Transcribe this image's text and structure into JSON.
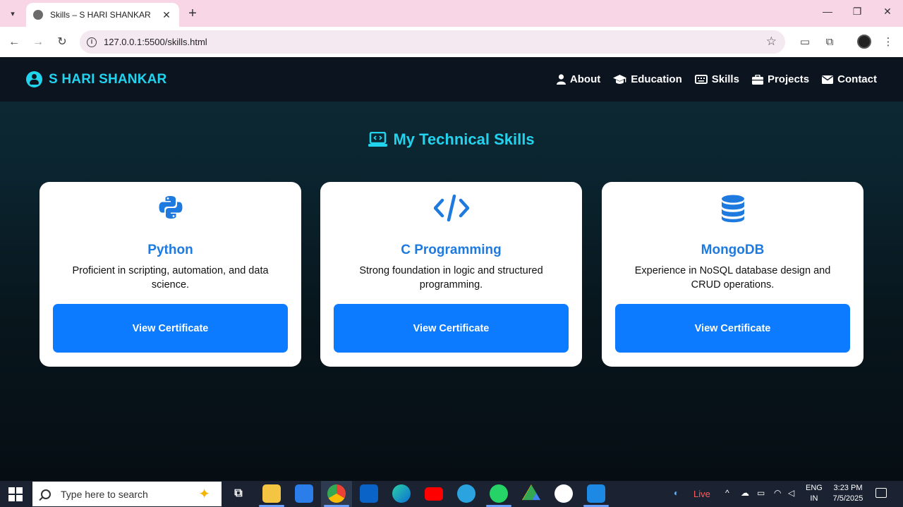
{
  "browser": {
    "tab_title": "Skills – S HARI SHANKAR",
    "url": "127.0.0.1:5500/skills.html",
    "new_tab_symbol": "+",
    "close_symbol": "✕"
  },
  "site": {
    "brand_name": "S HARI SHANKAR",
    "nav": [
      {
        "label": "About",
        "icon": "user-icon"
      },
      {
        "label": "Education",
        "icon": "graduation-cap-icon"
      },
      {
        "label": "Skills",
        "icon": "keyboard-icon"
      },
      {
        "label": "Projects",
        "icon": "briefcase-icon"
      },
      {
        "label": "Contact",
        "icon": "envelope-icon"
      }
    ],
    "section_title": "My Technical Skills",
    "accent_color": "#22d3ee",
    "button_color": "#0d7bff",
    "title_color": "#1f7ae0"
  },
  "cards": [
    {
      "title": "Python",
      "description": "Proficient in scripting, automation, and data science.",
      "button": "View Certificate",
      "icon": "python-icon"
    },
    {
      "title": "C Programming",
      "description": "Strong foundation in logic and structured programming.",
      "button": "View Certificate",
      "icon": "code-icon"
    },
    {
      "title": "MongoDB",
      "description": "Experience in NoSQL database design and CRUD operations.",
      "button": "View Certificate",
      "icon": "database-icon"
    }
  ],
  "taskbar": {
    "search_placeholder": "Type here to search",
    "live_label": "Live",
    "lang_top": "ENG",
    "lang_bottom": "IN",
    "time": "3:23 PM",
    "date": "7/5/2025"
  }
}
